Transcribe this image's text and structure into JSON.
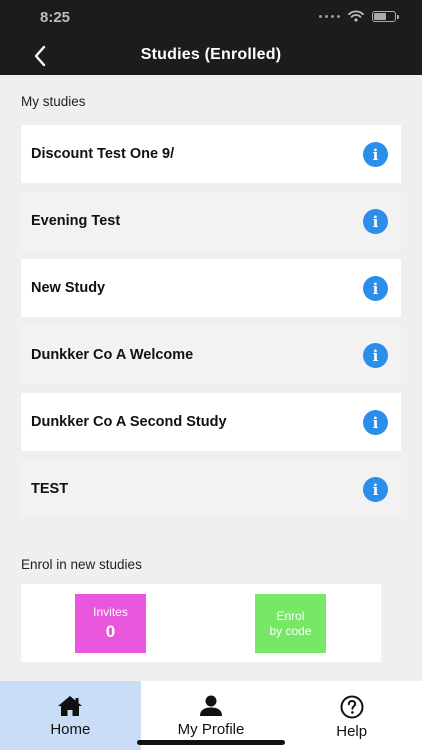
{
  "status_bar": {
    "time": "8:25",
    "icons": [
      "signal-icon",
      "wifi-icon",
      "battery-icon"
    ]
  },
  "nav": {
    "title": "Studies (Enrolled)",
    "back_icon": "chevron-left-icon"
  },
  "my_studies": {
    "label": "My studies",
    "items": [
      {
        "name": "Discount Test One 9/"
      },
      {
        "name": "Evening Test"
      },
      {
        "name": "New Study"
      },
      {
        "name": "Dunkker Co A Welcome"
      },
      {
        "name": "Dunkker Co A Second Study"
      },
      {
        "name": "TEST"
      }
    ],
    "info_icon": "info-icon",
    "info_glyph": "i",
    "info_color": "#2b8ee8"
  },
  "enrol": {
    "label": "Enrol in new studies",
    "invites": {
      "label": "Invites",
      "count": "0",
      "color": "#e957dc"
    },
    "by_code": {
      "line1": "Enrol",
      "line2": "by code",
      "color": "#76e865"
    }
  },
  "tabbar": {
    "tabs": [
      {
        "label": "Home",
        "icon": "home-icon",
        "active": true
      },
      {
        "label": "My Profile",
        "icon": "person-icon",
        "active": false
      },
      {
        "label": "Help",
        "icon": "help-icon",
        "active": false
      }
    ],
    "active_color": "#c9ddf6"
  }
}
